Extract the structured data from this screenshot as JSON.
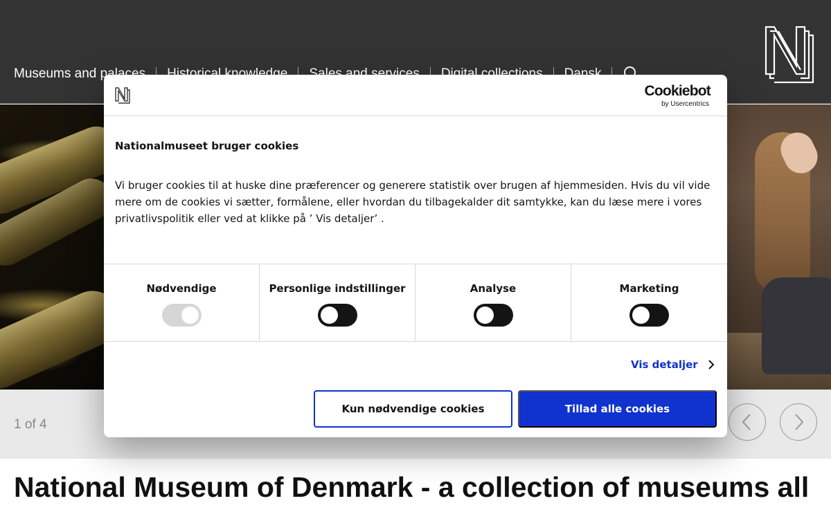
{
  "nav": {
    "items": [
      "Museums and palaces",
      "Historical knowledge",
      "Sales and services",
      "Digital collections",
      "Dansk"
    ],
    "search_icon": "search-icon",
    "logo": "nationalmuseet-logo"
  },
  "carousel": {
    "counter": "1 of 4",
    "prev_icon": "chevron-left-icon",
    "next_icon": "chevron-right-icon"
  },
  "page": {
    "heading": "National Museum of Denmark - a collection of museums all over the country"
  },
  "cookie_dialog": {
    "brand_logo": "N",
    "cookiebot_word": "Cookiebot",
    "cookiebot_sub": "by Usercentrics",
    "title": "Nationalmuseet bruger cookies",
    "text": "Vi bruger cookies til at huske dine præferencer og generere statistik over brugen af hjemmesiden. Hvis du vil vide mere om de cookies vi sætter, formålene, eller hvordan du tilbagekalder dit samtykke, kan du læse mere i vores privatlivspolitik eller ved at klikke på ’  Vis detaljer’  .",
    "toggles": [
      {
        "label": "Nødvendige",
        "on": true,
        "disabled": true
      },
      {
        "label": "Personlige indstillinger",
        "on": false,
        "disabled": false
      },
      {
        "label": "Analyse",
        "on": false,
        "disabled": false
      },
      {
        "label": "Marketing",
        "on": false,
        "disabled": false
      }
    ],
    "details_link": "Vis detaljer",
    "btn_necessary": "Kun nødvendige cookies",
    "btn_allow_all": "Tillad alle cookies",
    "accent_color": "#1032cf"
  }
}
